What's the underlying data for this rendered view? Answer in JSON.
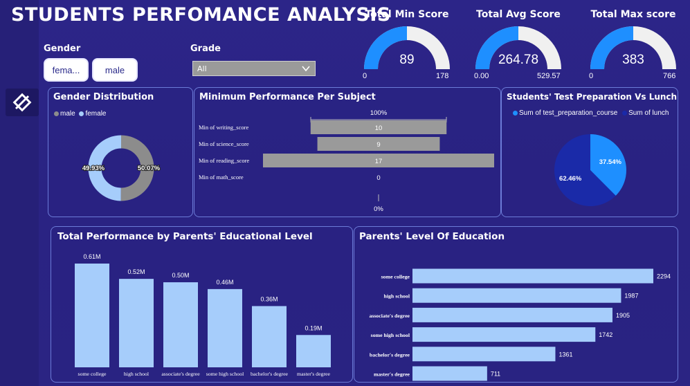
{
  "title": "STUDENTS PERFOMANCE ANALYSIS",
  "colors": {
    "accent_blue": "#1e8fff",
    "gauge_track": "#f0f0f0",
    "bar_light": "#a6cdfb",
    "bar_gray": "#9a9a9a",
    "donut_gray": "#8c8c8c",
    "pie_dark": "#1a2aa8"
  },
  "nav": {
    "icon": "diamond-icon"
  },
  "slicers": {
    "gender_label": "Gender",
    "gender_options": [
      "fema...",
      "male"
    ],
    "grade_label": "Grade",
    "grade_value": "All"
  },
  "kpis": [
    {
      "title": "Total Min Score",
      "value": "89",
      "min": "0",
      "max": "178",
      "fraction": 0.5
    },
    {
      "title": "Total Avg Score",
      "value": "264.78",
      "min": "0.00",
      "max": "529.57",
      "fraction": 0.5
    },
    {
      "title": "Total Max score",
      "value": "383",
      "min": "0",
      "max": "766",
      "fraction": 0.5
    }
  ],
  "chart_data": [
    {
      "type": "pie",
      "variant": "donut",
      "title": "Gender Distribution",
      "legend": [
        "male",
        "female"
      ],
      "legend_position": "top-left",
      "slices": [
        {
          "name": "male",
          "value": 50.07,
          "label": "50.07%"
        },
        {
          "name": "female",
          "value": 49.93,
          "label": "49.93%"
        }
      ]
    },
    {
      "type": "bar",
      "orientation": "horizontal",
      "title": "Minimum Performance Per Subject",
      "categories": [
        "Min of writing_score",
        "Min of science_score",
        "Min of reading_score",
        "Min of math_score"
      ],
      "values": [
        10,
        9,
        17,
        0
      ],
      "labels": [
        "10",
        "9",
        "17",
        "0"
      ],
      "top_label": "100%",
      "bottom_label": "0%"
    },
    {
      "type": "pie",
      "title": "Students' Test Preparation Vs Lunch",
      "legend": [
        "Sum of test_preparation_course",
        "Sum of lunch"
      ],
      "legend_position": "top",
      "slices": [
        {
          "name": "Sum of test_preparation_course",
          "value": 37.54,
          "label": "37.54%"
        },
        {
          "name": "Sum of lunch",
          "value": 62.46,
          "label": "62.46%"
        }
      ]
    },
    {
      "type": "bar",
      "orientation": "vertical",
      "title": "Total Performance by Parents' Educational Level",
      "categories": [
        "some college",
        "high school",
        "associate's degree",
        "some high school",
        "bachelor's degree",
        "master's degree"
      ],
      "values": [
        0.61,
        0.52,
        0.5,
        0.46,
        0.36,
        0.19
      ],
      "labels": [
        "0.61M",
        "0.52M",
        "0.50M",
        "0.46M",
        "0.36M",
        "0.19M"
      ]
    },
    {
      "type": "bar",
      "orientation": "horizontal",
      "title": "Parents' Level Of Education",
      "categories": [
        "some college",
        "high school",
        "associate's degree",
        "some high school",
        "bachelor's degree",
        "master's degree"
      ],
      "values": [
        2294,
        1987,
        1905,
        1742,
        1361,
        711
      ],
      "labels": [
        "2294",
        "1987",
        "1905",
        "1742",
        "1361",
        "711"
      ]
    }
  ]
}
